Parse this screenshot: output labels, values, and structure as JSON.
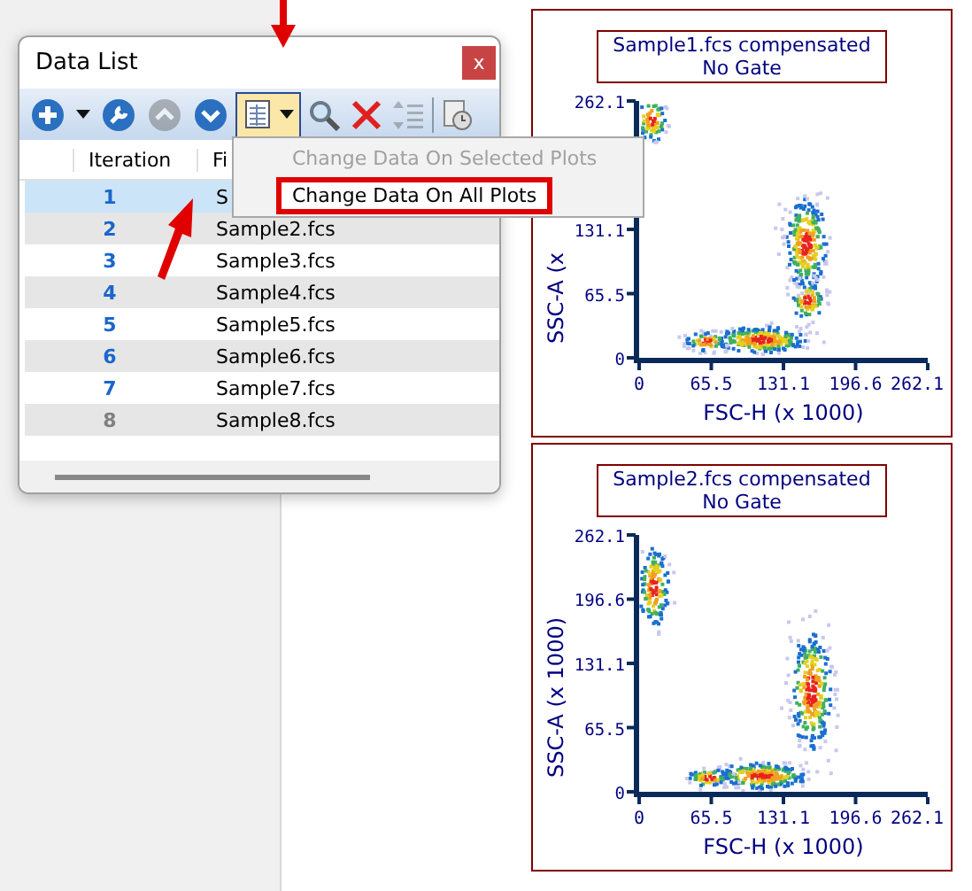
{
  "window": {
    "title": "Data List",
    "close": "x"
  },
  "toolbar": [
    {
      "kind": "add",
      "disabled": false,
      "pressed": false
    },
    {
      "kind": "dropdown",
      "disabled": false,
      "pressed": false
    },
    {
      "kind": "settings",
      "disabled": false,
      "pressed": false
    },
    {
      "kind": "up",
      "disabled": true,
      "pressed": false
    },
    {
      "kind": "down",
      "disabled": false,
      "pressed": false
    },
    {
      "kind": "datamenu",
      "disabled": false,
      "pressed": true
    },
    {
      "kind": "search",
      "disabled": false,
      "pressed": false
    },
    {
      "kind": "delete",
      "disabled": false,
      "pressed": false
    },
    {
      "kind": "sort",
      "disabled": true,
      "pressed": false
    },
    {
      "kind": "history",
      "disabled": false,
      "pressed": false
    }
  ],
  "table": {
    "columns": [
      "Iteration",
      "Fi"
    ],
    "rows": [
      {
        "iteration": "1",
        "file": "S",
        "selected": true,
        "disabled": false
      },
      {
        "iteration": "2",
        "file": "Sample2.fcs",
        "selected": false,
        "disabled": false
      },
      {
        "iteration": "3",
        "file": "Sample3.fcs",
        "selected": false,
        "disabled": false
      },
      {
        "iteration": "4",
        "file": "Sample4.fcs",
        "selected": false,
        "disabled": false
      },
      {
        "iteration": "5",
        "file": "Sample5.fcs",
        "selected": false,
        "disabled": false
      },
      {
        "iteration": "6",
        "file": "Sample6.fcs",
        "selected": false,
        "disabled": false
      },
      {
        "iteration": "7",
        "file": "Sample7.fcs",
        "selected": false,
        "disabled": false
      },
      {
        "iteration": "8",
        "file": "Sample8.fcs",
        "selected": false,
        "disabled": true
      }
    ]
  },
  "menu": [
    {
      "label": "Change Data On Selected Plots",
      "disabled": true,
      "highlighted": false
    },
    {
      "label": "Change Data On All Plots",
      "disabled": false,
      "highlighted": true
    }
  ],
  "plots": [
    {
      "title": "Sample1.fcs compensated",
      "subtitle": "No Gate",
      "xlabel": "FSC-H (x 1000)",
      "ylabel": "SSC-A (x",
      "xticks": [
        "0",
        "65.5",
        "131.1",
        "196.6",
        "262.1"
      ],
      "yticks": [
        "262.1",
        "131.1",
        "65.5",
        "0"
      ]
    },
    {
      "title": "Sample2.fcs compensated",
      "subtitle": "No Gate",
      "xlabel": "FSC-H (x 1000)",
      "ylabel": "SSC-A (x 1000)",
      "xticks": [
        "0",
        "65.5",
        "131.1",
        "196.6",
        "262.1"
      ],
      "yticks": [
        "262.1",
        "196.6",
        "131.1",
        "65.5",
        "0"
      ]
    }
  ]
}
